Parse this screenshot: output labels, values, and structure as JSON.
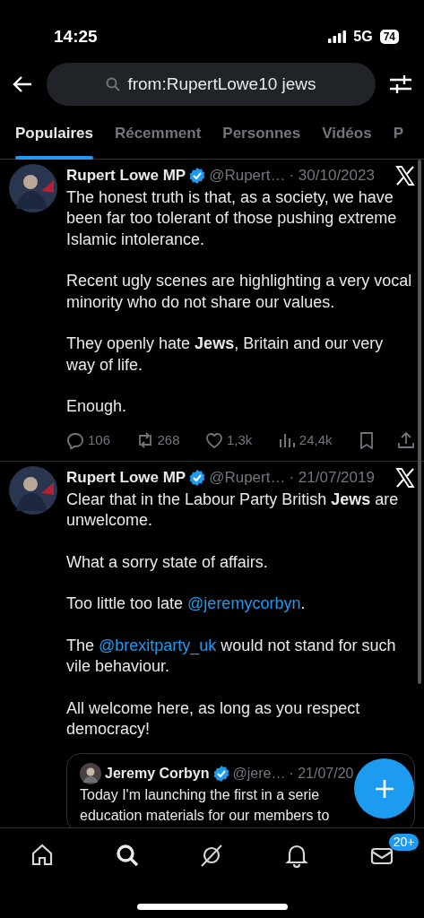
{
  "status_bar": {
    "time": "14:25",
    "network": "5G",
    "battery": "74"
  },
  "search": {
    "value": "from:RupertLowe10 jews"
  },
  "tabs": [
    {
      "label": "Populaires",
      "selected": true
    },
    {
      "label": "Récemment",
      "selected": false
    },
    {
      "label": "Personnes",
      "selected": false
    },
    {
      "label": "Vidéos",
      "selected": false
    },
    {
      "label": "P",
      "selected": false
    }
  ],
  "tweets": [
    {
      "name": "Rupert Lowe MP",
      "verified": true,
      "handle": "@Rupert…",
      "date": "· 30/10/2023",
      "paragraphs": [
        [
          {
            "kind": "text",
            "text": "The honest truth is that, as a society, we have been far too tolerant of those pushing extreme Islamic intolerance."
          }
        ],
        [
          {
            "kind": "text",
            "text": "Recent ugly scenes are highlighting a very vocal minority who do not share our values."
          }
        ],
        [
          {
            "kind": "text",
            "text": "They openly hate **Jews**, Britain and our very way of life."
          }
        ],
        [
          {
            "kind": "text",
            "text": "Enough."
          }
        ]
      ],
      "actions": {
        "replies": "106",
        "reposts": "268",
        "likes": "1,3k",
        "views": "24,4k"
      }
    },
    {
      "name": "Rupert Lowe MP",
      "verified": true,
      "handle": "@Rupert…",
      "date": "· 21/07/2019",
      "paragraphs": [
        [
          {
            "kind": "text",
            "text": "Clear that in the Labour Party British **Jews** are unwelcome."
          }
        ],
        [
          {
            "kind": "text",
            "text": "What a sorry state of affairs."
          }
        ],
        [
          {
            "kind": "text",
            "text": "Too little too late "
          },
          {
            "kind": "mention",
            "text": "@jeremycorbyn"
          },
          {
            "kind": "text",
            "text": "."
          }
        ],
        [
          {
            "kind": "text",
            "text": "The "
          },
          {
            "kind": "mention",
            "text": "@brexitparty_uk"
          },
          {
            "kind": "text",
            "text": " would not stand for such vile behaviour."
          }
        ],
        [
          {
            "kind": "text",
            "text": "All welcome here, as long as you respect democracy!"
          }
        ]
      ],
      "quote": {
        "name": "Jeremy Corbyn",
        "verified": true,
        "handle": "@jere…",
        "date": "· 21/07/20",
        "lines": [
          "Today I'm launching the first in a serie",
          "education materials for our members to"
        ]
      }
    }
  ],
  "bottom_nav": [
    {
      "kind": "home",
      "selected": false
    },
    {
      "kind": "search",
      "selected": true
    },
    {
      "kind": "grok",
      "selected": false
    },
    {
      "kind": "bell",
      "selected": false
    },
    {
      "kind": "mail",
      "selected": false,
      "badge": "20+"
    }
  ]
}
